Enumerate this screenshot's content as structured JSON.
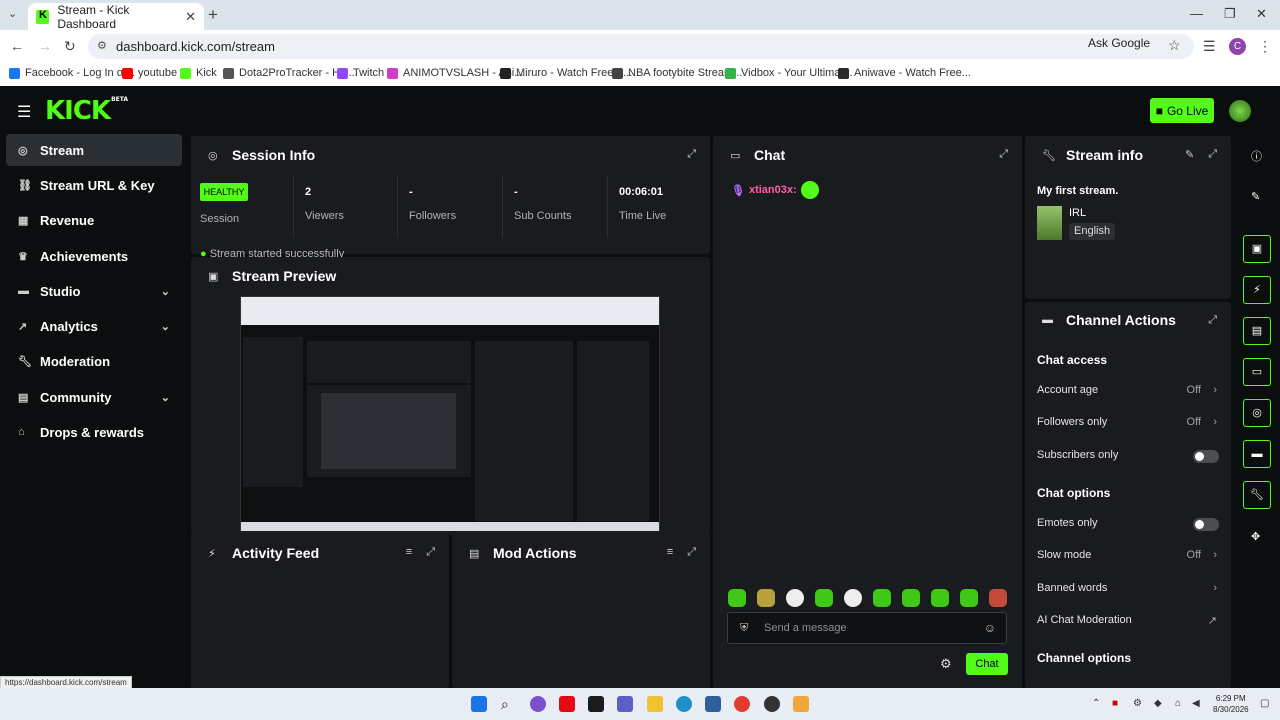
{
  "browser": {
    "tab_title": "Stream - Kick Dashboard",
    "url": "dashboard.kick.com/stream",
    "ask_google": "Ask Google",
    "profile_initial": "C",
    "bookmarks": [
      {
        "label": "Facebook - Log In or...",
        "color": "#1877f2"
      },
      {
        "label": "youtube",
        "color": "#ff0000"
      },
      {
        "label": "Kick",
        "color": "#53fc18"
      },
      {
        "label": "Dota2ProTracker - Hig...",
        "color": "#555555"
      },
      {
        "label": "Twitch",
        "color": "#9146ff"
      },
      {
        "label": "ANIMOTVSLASH - Ani...",
        "color": "#d13cc8"
      },
      {
        "label": "Miruro - Watch Free A...",
        "color": "#222222"
      },
      {
        "label": "NBA footybite Stream...",
        "color": "#444444"
      },
      {
        "label": "Vidbox - Your Ultimat...",
        "color": "#36b34a"
      },
      {
        "label": "Aniwave - Watch Free...",
        "color": "#2b2b2b"
      }
    ],
    "status_url": "https://dashboard.kick.com/stream"
  },
  "app": {
    "logo": "KICK",
    "logo_badge": "BETA",
    "go_live": "Go Live",
    "accent": "#53fc18"
  },
  "sidebar": {
    "items": [
      {
        "label": "Stream",
        "icon": "stream-icon",
        "active": true
      },
      {
        "label": "Stream URL & Key",
        "icon": "link-icon"
      },
      {
        "label": "Revenue",
        "icon": "revenue-icon"
      },
      {
        "label": "Achievements",
        "icon": "trophy-icon"
      },
      {
        "label": "Studio",
        "icon": "studio-icon",
        "expandable": true
      },
      {
        "label": "Analytics",
        "icon": "analytics-icon",
        "expandable": true
      },
      {
        "label": "Moderation",
        "icon": "wrench-icon"
      },
      {
        "label": "Community",
        "icon": "community-icon",
        "expandable": true
      },
      {
        "label": "Drops & rewards",
        "icon": "gift-icon"
      }
    ]
  },
  "session_info": {
    "title": "Session Info",
    "health": "HEALTHY",
    "health_label": "Session",
    "stats": [
      {
        "value": "2",
        "label": "Viewers"
      },
      {
        "value": "-",
        "label": "Followers"
      },
      {
        "value": "-",
        "label": "Sub Counts"
      },
      {
        "value": "00:06:01",
        "label": "Time Live"
      }
    ],
    "toast": "Stream started successfully"
  },
  "stream_preview": {
    "title": "Stream Preview"
  },
  "activity_feed": {
    "title": "Activity Feed"
  },
  "mod_actions": {
    "title": "Mod Actions"
  },
  "chat": {
    "title": "Chat",
    "messages": [
      {
        "user": "xtian03x:"
      }
    ],
    "placeholder": "Send a message",
    "send_label": "Chat"
  },
  "stream_info": {
    "title": "Stream info",
    "stream_title": "My first stream.",
    "category": "IRL",
    "language": "English"
  },
  "channel_actions": {
    "title": "Channel Actions",
    "chat_access_heading": "Chat access",
    "account_age": {
      "label": "Account age",
      "value": "Off"
    },
    "followers_only": {
      "label": "Followers only",
      "value": "Off"
    },
    "subscribers_only": {
      "label": "Subscribers only"
    },
    "chat_options_heading": "Chat options",
    "emotes_only": {
      "label": "Emotes only"
    },
    "slow_mode": {
      "label": "Slow mode",
      "value": "Off"
    },
    "banned_words": {
      "label": "Banned words"
    },
    "ai_moderation": {
      "label": "AI Chat Moderation"
    },
    "channel_options_heading": "Channel options"
  },
  "taskbar": {
    "time": "6:29 PM",
    "date": "8/30/2026"
  }
}
